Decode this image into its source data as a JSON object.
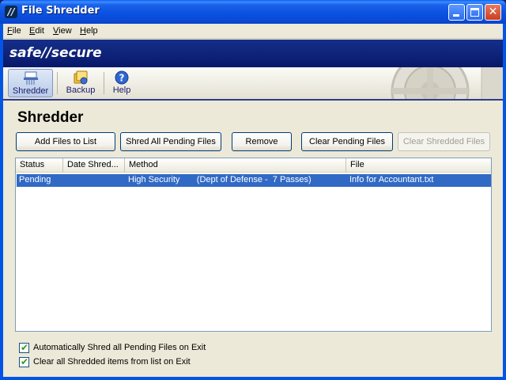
{
  "window": {
    "title": "File Shredder",
    "app_icon_glyph": "//"
  },
  "menubar": {
    "items": [
      {
        "label": "File",
        "accel": "F"
      },
      {
        "label": "Edit",
        "accel": "E"
      },
      {
        "label": "View",
        "accel": "V"
      },
      {
        "label": "Help",
        "accel": "H"
      }
    ]
  },
  "brand": {
    "logo_text": "safe//secure"
  },
  "toolbar": {
    "shredder_label": "Shredder",
    "backup_label": "Backup",
    "help_label": "Help"
  },
  "page": {
    "title": "Shredder"
  },
  "actions": {
    "add_files": "Add Files to List",
    "shred_all": "Shred All Pending Files",
    "remove": "Remove",
    "clear_pending": "Clear Pending Files",
    "clear_shredded": "Clear Shredded Files"
  },
  "list": {
    "columns": {
      "status": "Status",
      "date": "Date Shred...",
      "method": "Method",
      "file": "File"
    },
    "rows": [
      {
        "status": "Pending",
        "date": "",
        "method": "High Security       (Dept of Defense -  7 Passes)",
        "file": "Info for Accountant.txt"
      }
    ]
  },
  "options": {
    "auto_shred": {
      "label": "Automatically Shred all Pending Files on Exit",
      "checked": true
    },
    "clear_shredded": {
      "label": "Clear all Shredded items from list on Exit",
      "checked": true
    }
  },
  "colors": {
    "titlebar": "#0b52e0",
    "brandbar": "#08186a",
    "selection": "#316ac5",
    "client": "#ece9d8"
  },
  "icons": {
    "minimize": "minimize-icon",
    "maximize": "maximize-icon",
    "close": "close-icon",
    "shredder": "shredder-icon",
    "backup": "backup-icon",
    "help": "help-icon",
    "check": "checkmark-icon"
  }
}
